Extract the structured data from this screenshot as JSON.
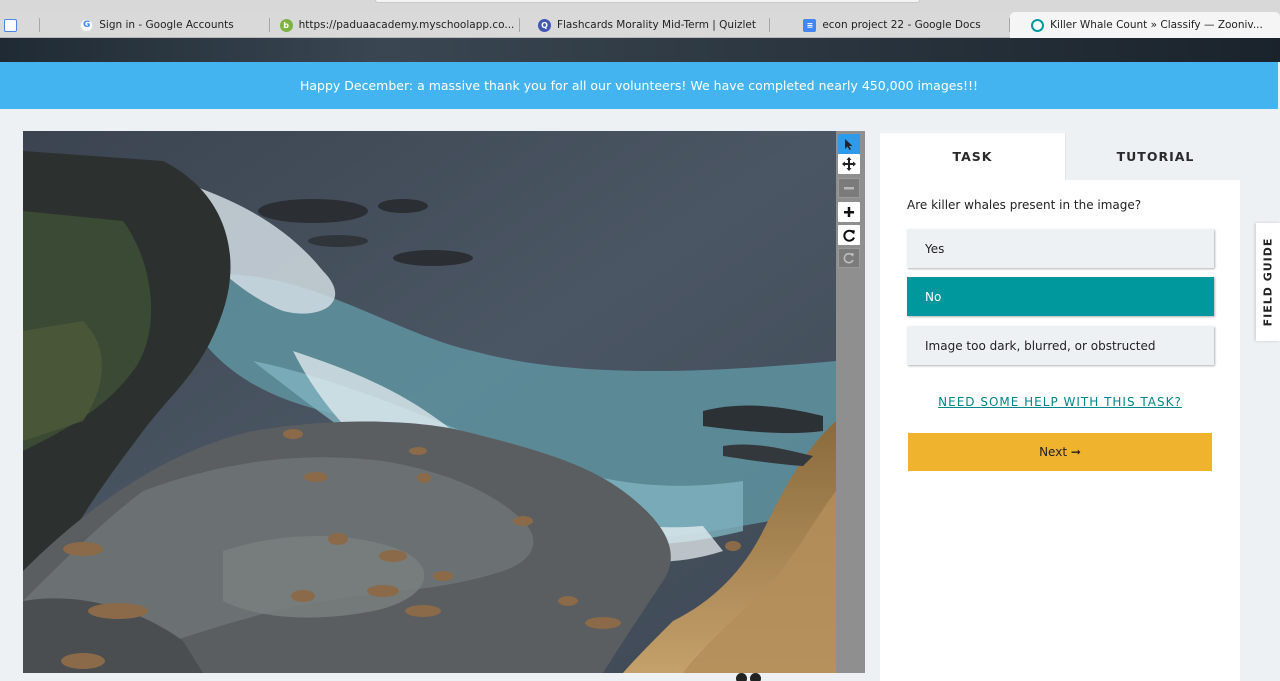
{
  "browser": {
    "tabs": [
      {
        "label": "",
        "icon": "window-icon",
        "color": "#4a86e8"
      },
      {
        "label": "Sign in - Google Accounts",
        "icon": "google-icon",
        "color": "#4285f4"
      },
      {
        "label": "https://paduaacademy.myschoolapp.co...",
        "icon": "myschoolapp-icon",
        "color": "#7cb342"
      },
      {
        "label": "Flashcards Morality Mid-Term | Quizlet",
        "icon": "quizlet-icon",
        "color": "#4257b2"
      },
      {
        "label": "econ project 22 - Google Docs",
        "icon": "docs-icon",
        "color": "#4285f4"
      },
      {
        "label": "Killer Whale Count » Classify — Zooniv...",
        "icon": "zooniverse-icon",
        "color": "#00979d"
      }
    ]
  },
  "announcement": {
    "text": "Happy December: a massive thank you for all our volunteers! We have completed nearly 450,000 images!!!",
    "color": "#43b4f0"
  },
  "subject": {
    "description_icon": "subject-photo"
  },
  "toolbar": {
    "tools": [
      "pointer-icon",
      "move-icon",
      "zoom-out-icon",
      "zoom-in-icon",
      "rotate-icon",
      "reset-icon"
    ]
  },
  "task_panel": {
    "tab_task": "TASK",
    "tab_tutorial": "TUTORIAL",
    "question": "Are killer whales present in the image?",
    "answers": [
      {
        "label": "Yes",
        "selected": false
      },
      {
        "label": "No",
        "selected": true
      },
      {
        "label": "Image too dark, blurred, or obstructed",
        "selected": false
      }
    ],
    "help_link": "NEED SOME HELP WITH THIS TASK?",
    "next_label": "Next ➞",
    "accent": "#00979d",
    "next_color": "#f0b32e"
  },
  "field_guide": {
    "label": "FIELD GUIDE"
  }
}
